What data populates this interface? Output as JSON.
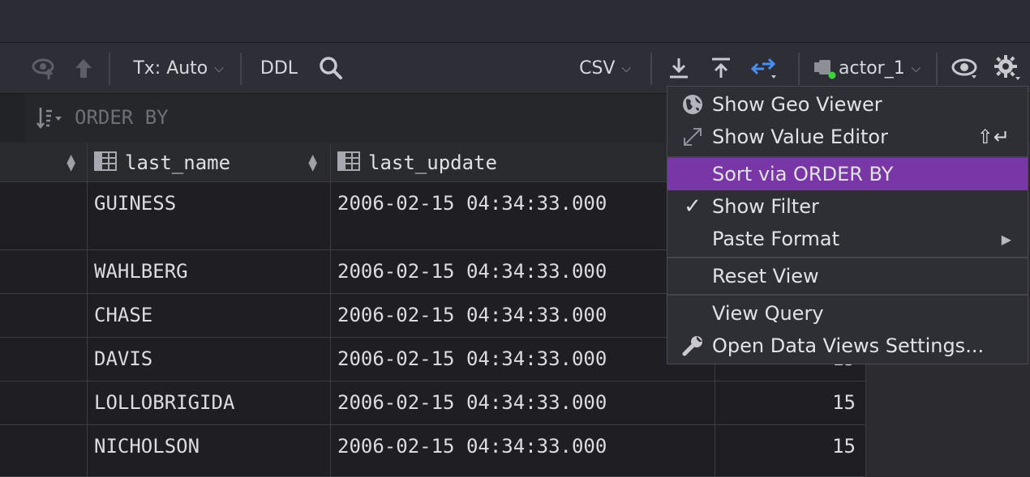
{
  "toolbar": {
    "tx_label": "Tx: Auto",
    "ddl_label": "DDL",
    "csv_label": "CSV",
    "connection_label": "actor_1"
  },
  "filter": {
    "order_by_placeholder": "ORDER BY"
  },
  "grid": {
    "columns": [
      "last_name",
      "last_update"
    ],
    "rows": [
      {
        "last_name": "GUINESS",
        "last_update": "2006-02-15 04:34:33.000",
        "extra": ""
      },
      {
        "last_name": "WAHLBERG",
        "last_update": "2006-02-15 04:34:33.000",
        "extra": ""
      },
      {
        "last_name": "CHASE",
        "last_update": "2006-02-15 04:34:33.000",
        "extra": ""
      },
      {
        "last_name": "DAVIS",
        "last_update": "2006-02-15 04:34:33.000",
        "extra": "15"
      },
      {
        "last_name": "LOLLOBRIGIDA",
        "last_update": "2006-02-15 04:34:33.000",
        "extra": "15"
      },
      {
        "last_name": "NICHOLSON",
        "last_update": "2006-02-15 04:34:33.000",
        "extra": "15"
      }
    ]
  },
  "menu": {
    "items": [
      {
        "label": "Show Geo Viewer",
        "icon": "globe-icon"
      },
      {
        "label": "Show Value Editor",
        "icon": "expand-icon",
        "shortcut": "⇧↵"
      },
      {
        "label": "Sort via ORDER BY",
        "selected": true
      },
      {
        "label": "Show Filter",
        "checked": true
      },
      {
        "label": "Paste Format",
        "submenu": true
      },
      {
        "label": "Reset View"
      },
      {
        "label": "View Query"
      },
      {
        "label": "Open Data Views Settings...",
        "icon": "wrench-icon"
      }
    ]
  },
  "colors": {
    "selection": "#7836a6",
    "accent_blue": "#4a8df0",
    "status_green": "#3ed13e"
  }
}
